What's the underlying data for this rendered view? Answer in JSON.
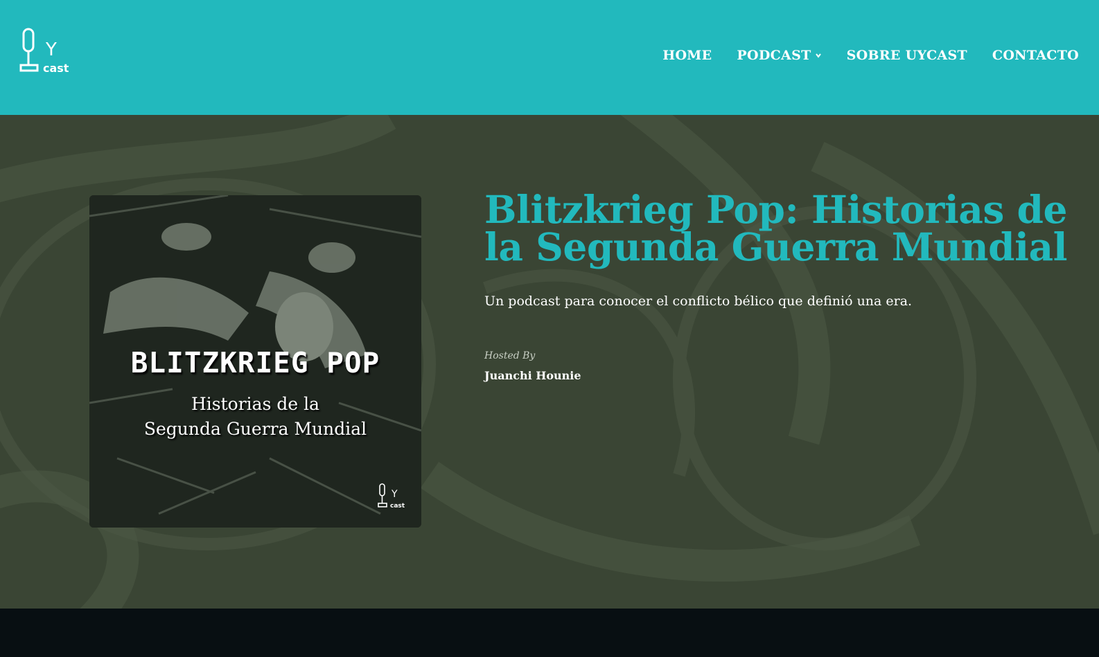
{
  "header": {
    "logo": {
      "mark": "Y",
      "word": "cast",
      "icon": "microphone-icon"
    },
    "nav": [
      {
        "label": "HOME",
        "has_dropdown": false
      },
      {
        "label": "PODCAST",
        "has_dropdown": true
      },
      {
        "label": "SOBRE UYCAST",
        "has_dropdown": false
      },
      {
        "label": "CONTACTO",
        "has_dropdown": false
      }
    ]
  },
  "podcast": {
    "cover": {
      "title": "BLITZKRIEG POP",
      "subtitle_line1": "Historias de la",
      "subtitle_line2": "Segunda Guerra Mundial",
      "logo_mark": "Y",
      "logo_word": "cast"
    },
    "title": "Blitzkrieg Pop: Historias de la Segunda Guerra Mundial",
    "description": "Un podcast para conocer el conflicto bélico que definió una era.",
    "hosted_label": "Hosted By",
    "host": "Juanchi Hounie"
  },
  "colors": {
    "accent": "#22b9bd",
    "hero_bg": "#3a4534",
    "footer_bg": "#080f12"
  }
}
